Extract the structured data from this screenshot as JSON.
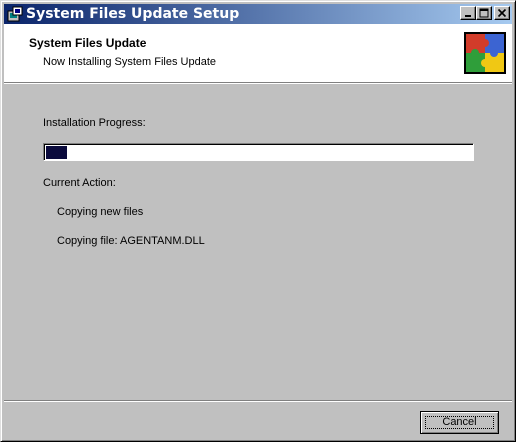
{
  "window": {
    "title": "System Files Update Setup",
    "title_icon": "setup-app-icon"
  },
  "caption_buttons": {
    "minimize_icon": "minimize-icon",
    "maximize_icon": "maximize-icon",
    "close_icon": "close-icon"
  },
  "header": {
    "title": "System Files Update",
    "subtitle": "Now Installing System Files Update",
    "logo_icon": "puzzle-logo-icon"
  },
  "progress": {
    "label": "Installation Progress:",
    "value": 0.05
  },
  "action": {
    "label": "Current Action:",
    "step": "Copying new files",
    "file": "Copying file: AGENTANM.DLL"
  },
  "buttons": {
    "cancel": "Cancel"
  },
  "colors": {
    "titlebar_start": "#0a246a",
    "titlebar_end": "#a6caf0",
    "dialog_face": "#c0c0c0",
    "progress_fill": "#0a0a3c"
  }
}
